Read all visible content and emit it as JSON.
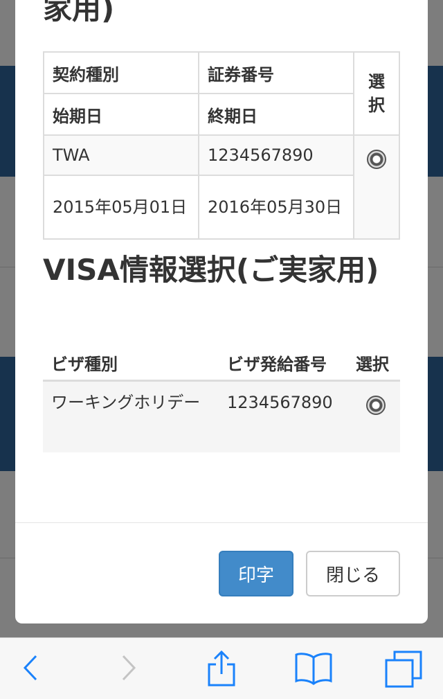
{
  "section1": {
    "title_partial": "家用)",
    "table": {
      "headers": {
        "contract_type": "契約種別",
        "policy_number": "証券番号",
        "start_date": "始期日",
        "end_date": "終期日",
        "select": "選択"
      },
      "row": {
        "contract_type": "TWA",
        "policy_number": "1234567890",
        "start_date": "2015年05月01日",
        "end_date": "2016年05月30日"
      }
    }
  },
  "section2": {
    "title": "VISA情報選択(ご実家用)",
    "table": {
      "headers": {
        "visa_type": "ビザ種別",
        "visa_number": "ビザ発給番号",
        "select": "選択"
      },
      "row": {
        "visa_type": "ワーキングホリデー",
        "visa_number": "1234567890"
      }
    }
  },
  "buttons": {
    "print": "印字",
    "close": "閉じる"
  },
  "colors": {
    "primary": "#428bca",
    "toolbar_icon": "#1a82fb"
  },
  "toolbar": {
    "icons": [
      "back-icon",
      "forward-icon",
      "share-icon",
      "bookmarks-icon",
      "tabs-icon"
    ]
  }
}
